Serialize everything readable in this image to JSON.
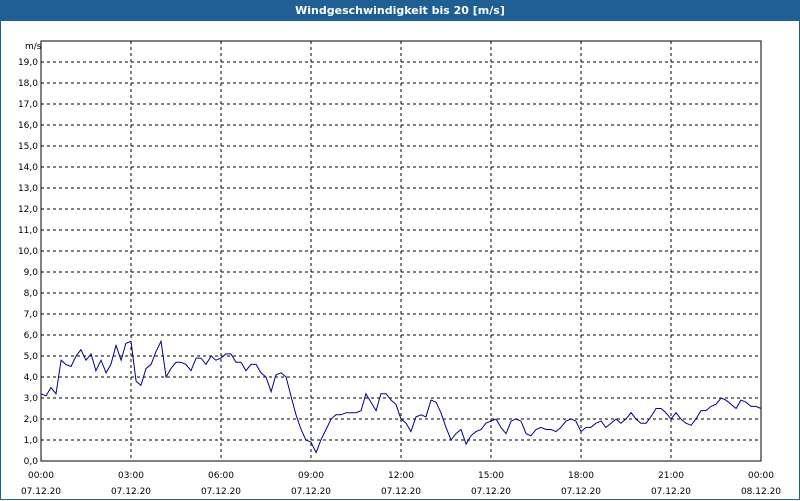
{
  "window": {
    "title": "Windgeschwindigkeit bis 20 [m/s]"
  },
  "chart_data": {
    "type": "line",
    "title": "Windgeschwindigkeit bis 20 [m/s]",
    "ylabel": "m/s",
    "ylim": [
      0,
      20
    ],
    "xlim_hours": [
      0,
      24
    ],
    "grid": true,
    "grid_style": "dashed",
    "line_color": "#00008b",
    "y_ticks": [
      "0,0",
      "1,0",
      "2,0",
      "3,0",
      "4,0",
      "5,0",
      "6,0",
      "7,0",
      "8,0",
      "9,0",
      "10,0",
      "11,0",
      "12,0",
      "13,0",
      "14,0",
      "15,0",
      "16,0",
      "17,0",
      "18,0",
      "19,0"
    ],
    "x_ticks": [
      {
        "time": "00:00",
        "date": "07.12.20"
      },
      {
        "time": "03:00",
        "date": "07.12.20"
      },
      {
        "time": "06:00",
        "date": "07.12.20"
      },
      {
        "time": "09:00",
        "date": "07.12.20"
      },
      {
        "time": "12:00",
        "date": "07.12.20"
      },
      {
        "time": "15:00",
        "date": "07.12.20"
      },
      {
        "time": "18:00",
        "date": "07.12.20"
      },
      {
        "time": "21:00",
        "date": "07.12.20"
      },
      {
        "time": "00:00",
        "date": "08.12.20"
      }
    ],
    "series": [
      {
        "x": [
          0.0,
          0.17,
          0.33,
          0.5,
          0.67,
          0.83,
          1.0,
          1.17,
          1.33,
          1.5,
          1.67,
          1.83,
          2.0,
          2.17,
          2.33,
          2.5,
          2.67,
          2.83,
          3.0,
          3.17,
          3.33,
          3.5,
          3.67,
          3.83,
          4.0,
          4.17,
          4.33,
          4.5,
          4.67,
          4.83,
          5.0,
          5.17,
          5.33,
          5.5,
          5.67,
          5.83,
          6.0,
          6.17,
          6.33,
          6.5,
          6.67,
          6.83,
          7.0,
          7.17,
          7.33,
          7.5,
          7.67,
          7.83,
          8.0,
          8.17,
          8.33,
          8.5,
          8.67,
          8.83,
          9.0,
          9.17,
          9.33,
          9.5,
          9.67,
          9.83,
          10.0,
          10.17,
          10.33,
          10.5,
          10.67,
          10.83,
          11.0,
          11.17,
          11.33,
          11.5,
          11.67,
          11.83,
          12.0,
          12.17,
          12.33,
          12.5,
          12.67,
          12.83,
          13.0,
          13.17,
          13.33,
          13.5,
          13.67,
          13.83,
          14.0,
          14.17,
          14.33,
          14.5,
          14.67,
          14.83,
          15.0,
          15.17,
          15.33,
          15.5,
          15.67,
          15.83,
          16.0,
          16.17,
          16.33,
          16.5,
          16.67,
          16.83,
          17.0,
          17.17,
          17.33,
          17.5,
          17.67,
          17.83,
          18.0,
          18.17,
          18.33,
          18.5,
          18.67,
          18.83,
          19.0,
          19.17,
          19.33,
          19.5,
          19.67,
          19.83,
          20.0,
          20.17,
          20.33,
          20.5,
          20.67,
          20.83,
          21.0,
          21.17,
          21.33,
          21.5,
          21.67,
          21.83,
          22.0,
          22.17,
          22.33,
          22.5,
          22.67,
          22.83,
          23.0,
          23.17,
          23.33,
          23.5,
          23.67,
          23.83,
          24.0
        ],
        "y": [
          3.2,
          3.1,
          3.5,
          3.2,
          4.8,
          4.6,
          4.5,
          5.0,
          5.3,
          4.8,
          5.1,
          4.3,
          4.8,
          4.2,
          4.6,
          5.5,
          4.8,
          5.6,
          5.7,
          3.8,
          3.6,
          4.4,
          4.6,
          5.2,
          5.7,
          4.0,
          4.4,
          4.7,
          4.7,
          4.6,
          4.3,
          4.9,
          4.9,
          4.6,
          5.0,
          4.8,
          4.9,
          5.1,
          5.1,
          4.7,
          4.7,
          4.3,
          4.6,
          4.6,
          4.2,
          4.0,
          3.3,
          4.1,
          4.2,
          4.0,
          3.1,
          2.2,
          1.5,
          1.0,
          0.9,
          0.4,
          1.0,
          1.5,
          2.0,
          2.2,
          2.2,
          2.3,
          2.3,
          2.3,
          2.4,
          3.2,
          2.8,
          2.4,
          3.2,
          3.2,
          2.9,
          2.7,
          2.0,
          1.8,
          1.4,
          2.1,
          2.2,
          2.1,
          2.9,
          2.8,
          2.3,
          1.6,
          1.0,
          1.3,
          1.5,
          0.8,
          1.2,
          1.4,
          1.5,
          1.8,
          1.9,
          2.0,
          1.6,
          1.3,
          1.9,
          2.0,
          1.9,
          1.3,
          1.2,
          1.5,
          1.6,
          1.5,
          1.5,
          1.4,
          1.6,
          1.9,
          2.0,
          1.9,
          1.4,
          1.6,
          1.6,
          1.8,
          1.9,
          1.6,
          1.8,
          2.0,
          1.8,
          2.0,
          2.3,
          2.0,
          1.8,
          1.8,
          2.1,
          2.5,
          2.5,
          2.3,
          2.0,
          2.3,
          2.0,
          1.8,
          1.7,
          2.0,
          2.4,
          2.4,
          2.6,
          2.7,
          3.0,
          2.9,
          2.7,
          2.5,
          2.9,
          2.8,
          2.6,
          2.6,
          2.5
        ]
      }
    ]
  }
}
